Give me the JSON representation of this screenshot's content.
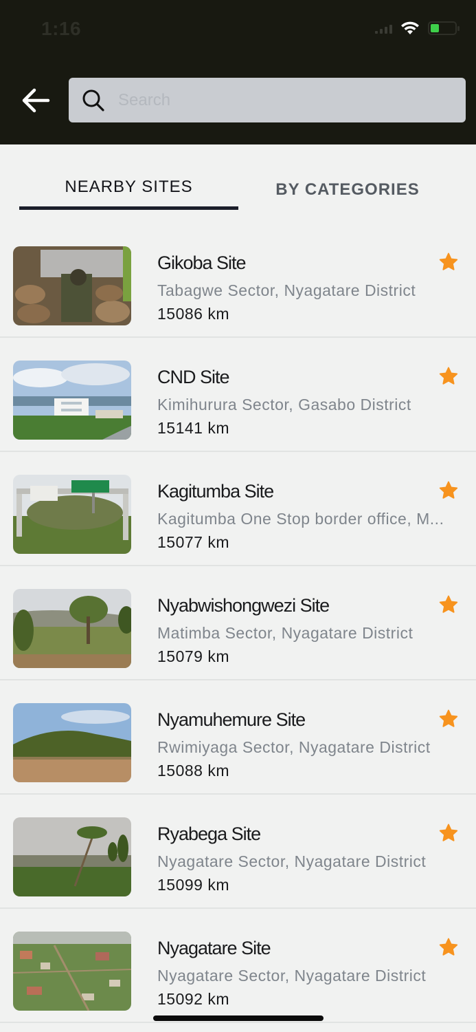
{
  "status_bar": {
    "time": "1:16"
  },
  "search": {
    "placeholder": "Search"
  },
  "tabs": [
    {
      "label": "NEARBY SITES",
      "active": true
    },
    {
      "label": "BY CATEGORIES",
      "active": false
    }
  ],
  "colors": {
    "header": "#181911",
    "star": "#f7931e",
    "tab_underline": "#1b1e2a",
    "background": "#f1f2f1"
  },
  "sites": [
    {
      "name": "Gikoba Site",
      "location": "Tabagwe Sector, Nyagatare District",
      "distance": "15086 km",
      "favorite": true,
      "image": "gikoba-photo"
    },
    {
      "name": "CND Site",
      "location": "Kimihurura Sector, Gasabo District",
      "distance": "15141 km",
      "favorite": true,
      "image": "cnd-photo"
    },
    {
      "name": "Kagitumba Site",
      "location": "Kagitumba One Stop border office, M...",
      "distance": "15077 km",
      "favorite": true,
      "image": "kagitumba-photo"
    },
    {
      "name": "Nyabwishongwezi Site",
      "location": "Matimba Sector, Nyagatare District",
      "distance": "15079 km",
      "favorite": true,
      "image": "nyabwishongwezi-photo"
    },
    {
      "name": "Nyamuhemure Site",
      "location": "Rwimiyaga Sector, Nyagatare District",
      "distance": "15088 km",
      "favorite": true,
      "image": "nyamuhemure-photo"
    },
    {
      "name": "Ryabega Site",
      "location": "Nyagatare Sector, Nyagatare District",
      "distance": "15099 km",
      "favorite": true,
      "image": "ryabega-photo"
    },
    {
      "name": "Nyagatare Site",
      "location": "Nyagatare Sector, Nyagatare District",
      "distance": "15092 km",
      "favorite": true,
      "image": "nyagatare-photo"
    }
  ]
}
